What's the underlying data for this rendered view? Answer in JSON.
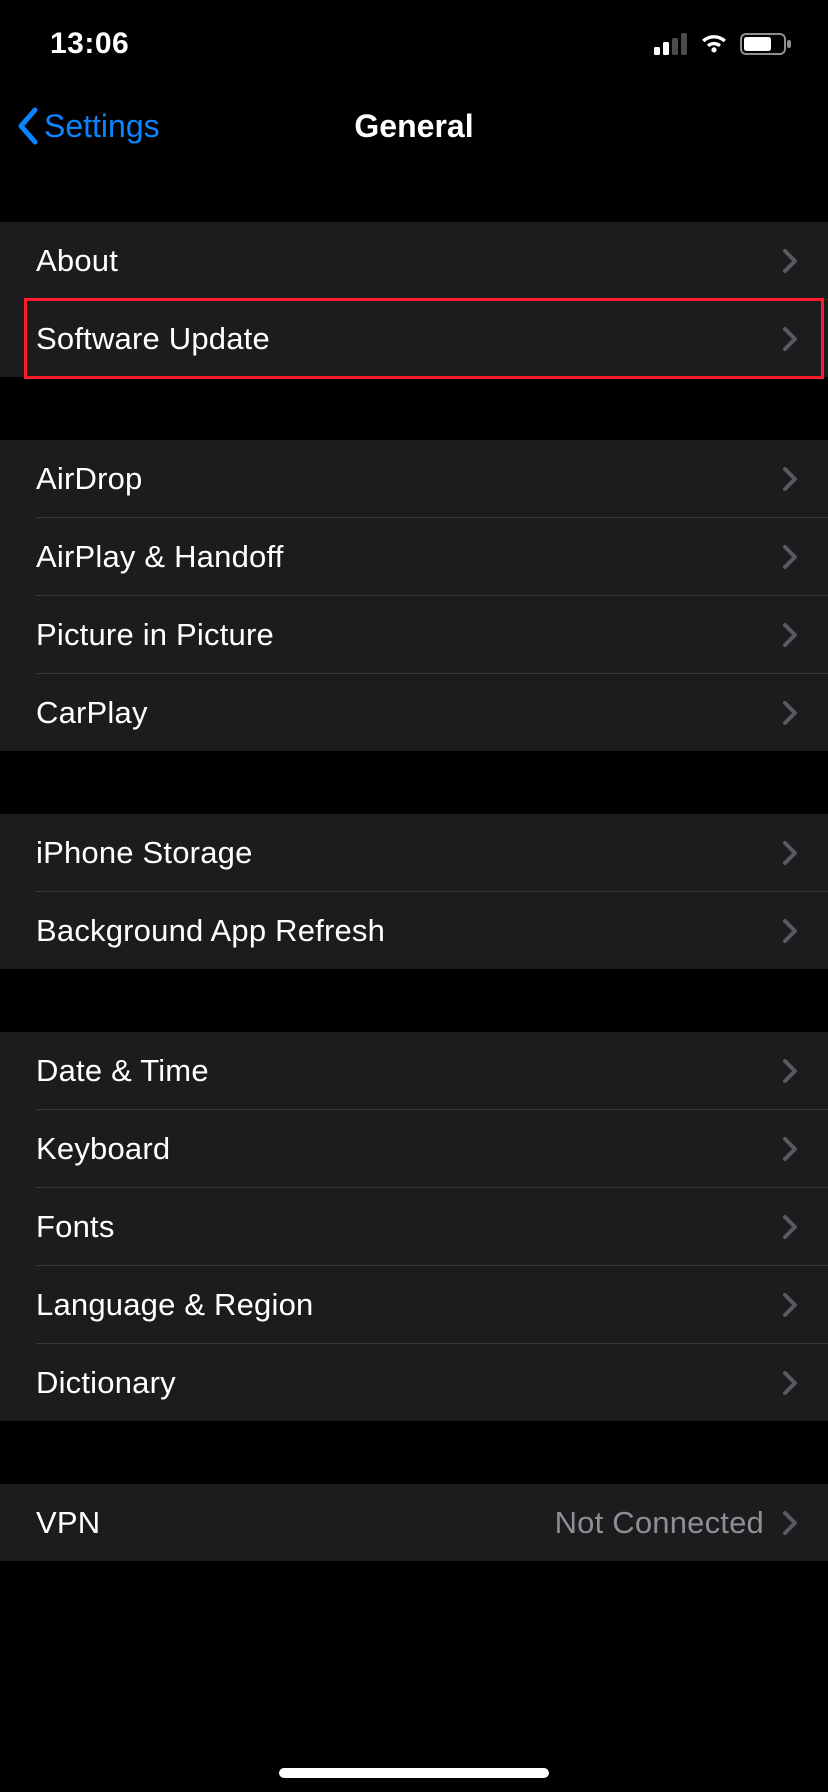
{
  "status": {
    "time": "13:06"
  },
  "nav": {
    "back_label": "Settings",
    "title": "General"
  },
  "groups": [
    {
      "rows": [
        {
          "label": "About",
          "value": "",
          "highlight": false
        },
        {
          "label": "Software Update",
          "value": "",
          "highlight": true
        }
      ]
    },
    {
      "rows": [
        {
          "label": "AirDrop",
          "value": "",
          "highlight": false
        },
        {
          "label": "AirPlay & Handoff",
          "value": "",
          "highlight": false
        },
        {
          "label": "Picture in Picture",
          "value": "",
          "highlight": false
        },
        {
          "label": "CarPlay",
          "value": "",
          "highlight": false
        }
      ]
    },
    {
      "rows": [
        {
          "label": "iPhone Storage",
          "value": "",
          "highlight": false
        },
        {
          "label": "Background App Refresh",
          "value": "",
          "highlight": false
        }
      ]
    },
    {
      "rows": [
        {
          "label": "Date & Time",
          "value": "",
          "highlight": false
        },
        {
          "label": "Keyboard",
          "value": "",
          "highlight": false
        },
        {
          "label": "Fonts",
          "value": "",
          "highlight": false
        },
        {
          "label": "Language & Region",
          "value": "",
          "highlight": false
        },
        {
          "label": "Dictionary",
          "value": "",
          "highlight": false
        }
      ]
    },
    {
      "rows": [
        {
          "label": "VPN",
          "value": "Not Connected",
          "highlight": false
        }
      ]
    }
  ],
  "colors": {
    "accent": "#0a84ff",
    "row_bg": "#1c1c1e",
    "separator": "#3a3a3c",
    "secondary_text": "#8e8e93",
    "highlight_border": "#ff1a2a"
  }
}
